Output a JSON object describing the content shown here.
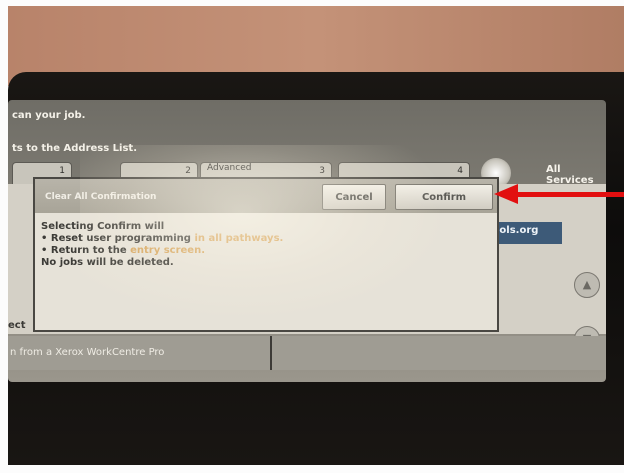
{
  "background": {
    "instruction_line": "can your job.",
    "address_line": "ts to the Address List.",
    "selected_label": "ect",
    "bottom_text": "n from a Xerox WorkCentre Pro",
    "email_fragment": "iols.org"
  },
  "tabs": [
    {
      "label": "",
      "number": "1"
    },
    {
      "label": "",
      "number": "2"
    },
    {
      "label": "Advanced",
      "number": "3"
    },
    {
      "label": "",
      "number": "4"
    }
  ],
  "all_services": {
    "label_line1": "All",
    "label_line2": "Services"
  },
  "dialog": {
    "title": "Clear All Confirmation",
    "cancel_label": "Cancel",
    "confirm_label": "Confirm",
    "body": {
      "line1": "Selecting Confirm will",
      "line2_prefix": "• Reset user programming",
      "line2_highlight": " in all pathways.",
      "line3_prefix": "• Return to the",
      "line3_highlight": " entry screen.",
      "line4": "No jobs will be deleted."
    }
  },
  "scroll_buttons": {
    "up_icon": "▲",
    "down_icon": "▼"
  },
  "colors": {
    "annotation_arrow": "#e20f10",
    "dialog_bg": "#e6e2d8",
    "highlight_text": "#d6a55d"
  }
}
